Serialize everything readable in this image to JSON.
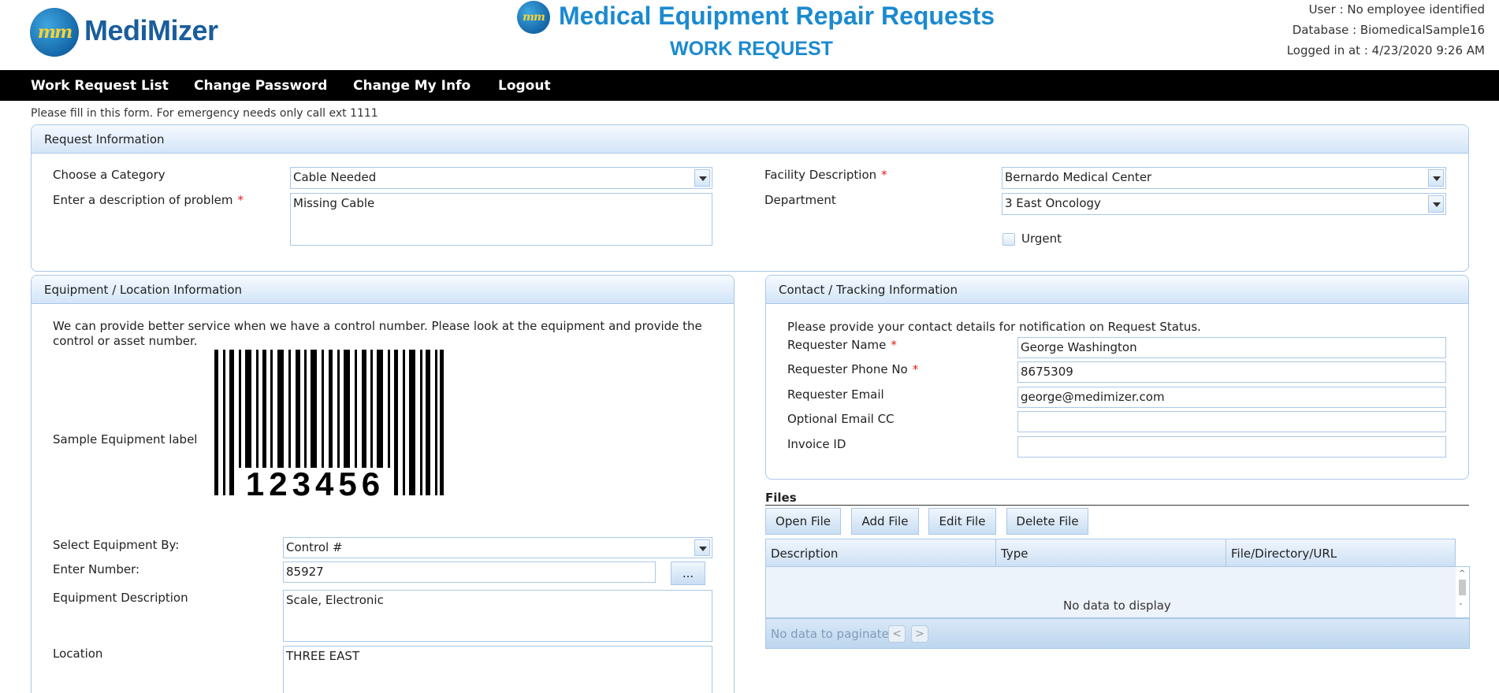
{
  "brand": {
    "logo_mark": "mm",
    "name": "MediMizer"
  },
  "header": {
    "title": "Medical Equipment Repair Requests",
    "subtitle": "WORK REQUEST",
    "user": "User : No employee identified",
    "database": "Database : BiomedicalSample16",
    "logged_in": "Logged in at : 4/23/2020 9:26 AM"
  },
  "nav": {
    "items": [
      "Work Request List",
      "Change Password",
      "Change My Info",
      "Logout"
    ]
  },
  "notice": "Please fill in this form. For emergency needs only call ext 1111",
  "request_info": {
    "title": "Request Information",
    "category_label": "Choose a Category",
    "category_value": "Cable Needed",
    "problem_label": "Enter a description of problem",
    "problem_value": "Missing Cable",
    "facility_label": "Facility Description",
    "facility_value": "Bernardo Medical Center",
    "department_label": "Department",
    "department_value": "3 East Oncology",
    "urgent_label": "Urgent",
    "required_mark": "*"
  },
  "equipment": {
    "title": "Equipment / Location Information",
    "intro": "We can provide better service when we have a control number. Please look at the equipment and provide the control or asset number.",
    "sample_label": "Sample Equipment label",
    "barcode_digits": "123456",
    "select_by_label": "Select Equipment By:",
    "select_by_value": "Control #",
    "number_label": "Enter Number:",
    "number_value": "85927",
    "lookup_button": "...",
    "description_label": "Equipment Description",
    "description_value": "Scale, Electronic",
    "location_label": "Location",
    "location_value": "THREE EAST"
  },
  "contact": {
    "title": "Contact / Tracking Information",
    "intro": "Please provide your contact details for notification on Request Status.",
    "name_label": "Requester Name",
    "name_value": "George Washington",
    "phone_label": "Requester Phone No",
    "phone_value": "8675309",
    "email_label": "Requester Email",
    "email_value": "george@medimizer.com",
    "cc_label": "Optional Email CC",
    "cc_value": "",
    "invoice_label": "Invoice ID",
    "invoice_value": ""
  },
  "files": {
    "title": "Files",
    "buttons": [
      "Open File",
      "Add File",
      "Edit File",
      "Delete File"
    ],
    "columns": [
      "Description",
      "Type",
      "File/Directory/URL"
    ],
    "empty_text": "No data to display",
    "pager_text": "No data to paginate",
    "prev_glyph": "<",
    "next_glyph": ">"
  }
}
